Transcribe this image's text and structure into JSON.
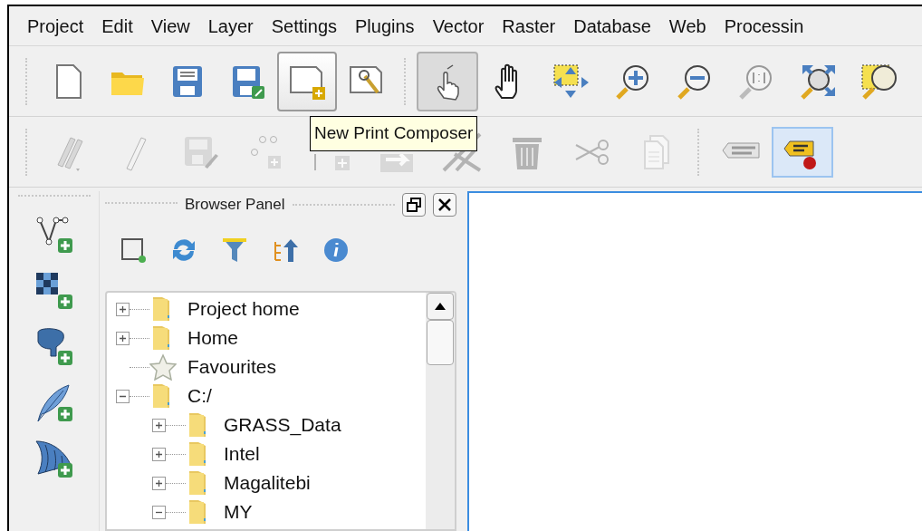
{
  "menu": [
    "Project",
    "Edit",
    "View",
    "Layer",
    "Settings",
    "Plugins",
    "Vector",
    "Raster",
    "Database",
    "Web",
    "Processin"
  ],
  "toolbar_file": [
    {
      "hovered": false
    },
    {
      "hovered": false
    },
    {
      "hovered": false
    },
    {
      "hovered": false
    },
    {
      "hovered": true
    },
    {
      "hovered": false
    }
  ],
  "toolbar_map": [
    {
      "pressed": true
    },
    {
      "pressed": false
    },
    {
      "pressed": false
    },
    {
      "pressed": false
    },
    {
      "pressed": false
    },
    {
      "pressed": false
    },
    {
      "pressed": false
    },
    {
      "pressed": false
    }
  ],
  "toolbar_edit": [
    {
      "disabled": true
    },
    {
      "disabled": true
    },
    {
      "disabled": true
    },
    {
      "disabled": true
    },
    {
      "disabled": true
    },
    {
      "disabled": true
    },
    {
      "disabled": true
    },
    {
      "disabled": true
    },
    {
      "disabled": true
    },
    {
      "disabled": true
    }
  ],
  "toolbar_label": [
    {
      "selected": false
    },
    {
      "selected": true
    }
  ],
  "tooltip": "New Print Composer",
  "browser_panel": {
    "title": "Browser Panel",
    "tree": [
      {
        "label": "Project home",
        "kind": "folder",
        "expanded": false
      },
      {
        "label": "Home",
        "kind": "folder",
        "expanded": false
      },
      {
        "label": "Favourites",
        "kind": "favourites"
      },
      {
        "label": "C:/",
        "kind": "folder",
        "expanded": true,
        "children": [
          {
            "label": "GRASS_Data",
            "kind": "folder",
            "expanded": false
          },
          {
            "label": "Intel",
            "kind": "folder",
            "expanded": false
          },
          {
            "label": "Magalitebi",
            "kind": "folder",
            "expanded": false
          },
          {
            "label": "MY",
            "kind": "folder",
            "expanded": true
          }
        ]
      }
    ]
  }
}
